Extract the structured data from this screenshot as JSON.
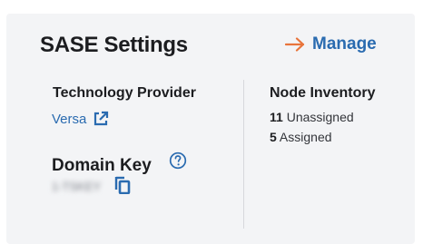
{
  "card": {
    "title": "SASE Settings",
    "manage_label": "Manage",
    "technology_provider": {
      "label": "Technology Provider",
      "value": "Versa"
    },
    "node_inventory": {
      "label": "Node Inventory",
      "unassigned_count": "11",
      "unassigned_label": "Unassigned",
      "assigned_count": "5",
      "assigned_label": "Assigned"
    },
    "domain_key": {
      "label": "Domain Key",
      "value": "1-TSKEY"
    }
  },
  "icons": {
    "manage": "arrow-right-icon",
    "provider": "external-link-icon",
    "domain_help": "help-circle-icon",
    "domain_copy": "copy-icon"
  },
  "colors": {
    "card_background": "#f3f4f6",
    "link_blue": "#2a6bb0",
    "arrow_orange": "#e8743b",
    "title_text": "#1c1d20"
  }
}
